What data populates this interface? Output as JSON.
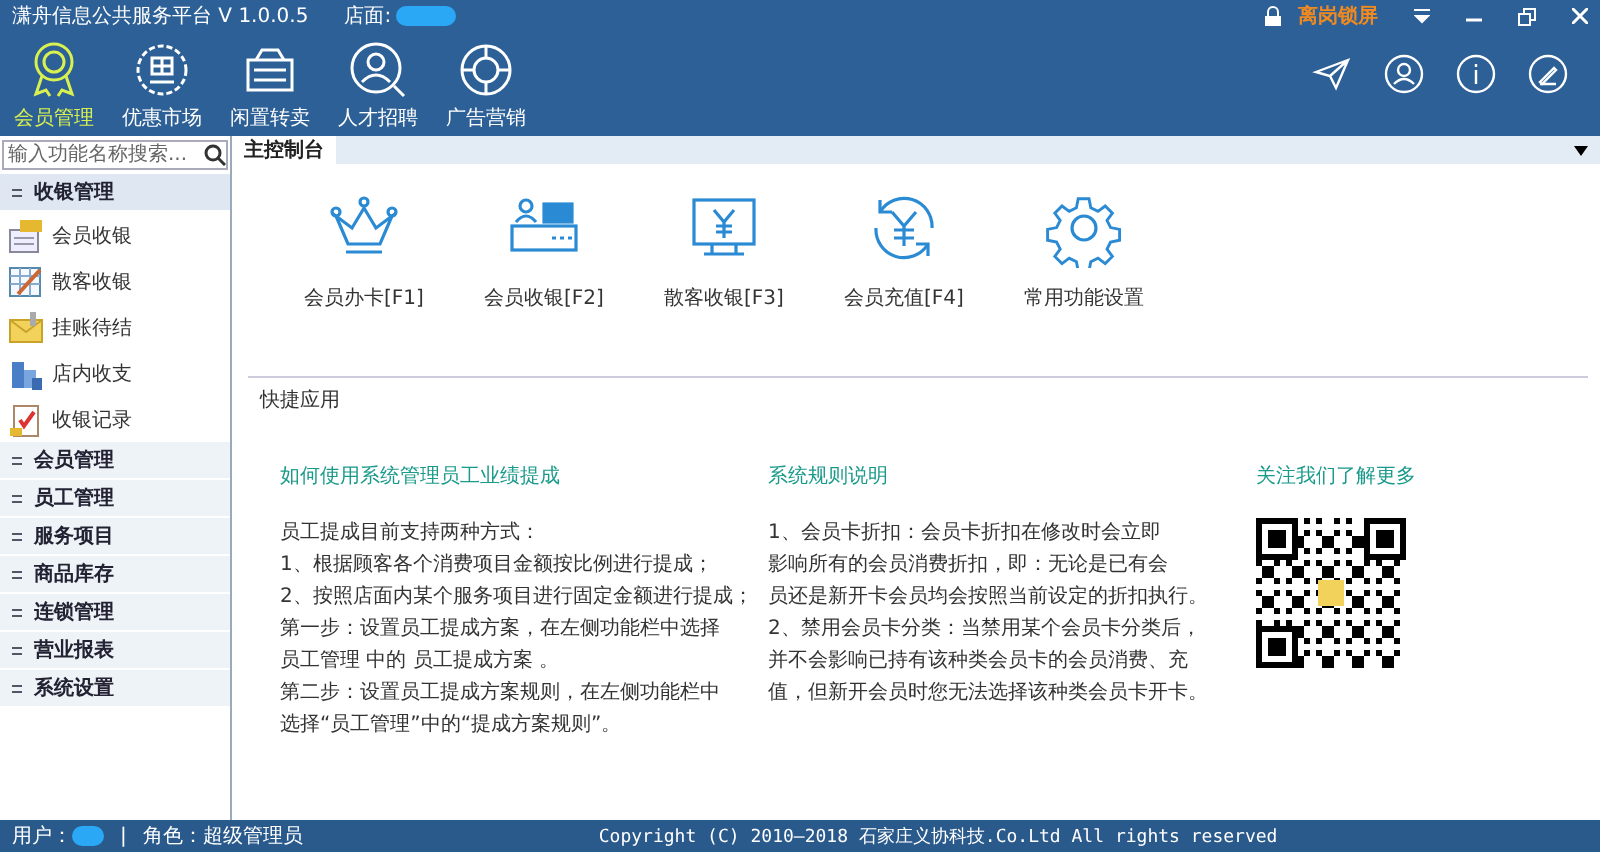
{
  "window": {
    "title": "潇舟信息公共服务平台 V 1.0.0.5",
    "store_label": "店面:",
    "lock_label": "离岗锁屏"
  },
  "nav": [
    {
      "label": "会员管理",
      "kind": "medal",
      "selected": true
    },
    {
      "label": "优惠市场",
      "kind": "coupon",
      "selected": false
    },
    {
      "label": "闲置转卖",
      "kind": "sale",
      "selected": false
    },
    {
      "label": "人才招聘",
      "kind": "person",
      "selected": false
    },
    {
      "label": "广告营销",
      "kind": "ring",
      "selected": false
    }
  ],
  "sidebar": {
    "search_placeholder": "输入功能名称搜索...",
    "groups": [
      {
        "label": "收银管理",
        "expanded": true,
        "children": [
          {
            "label": "会员收银",
            "kind": "register"
          },
          {
            "label": "散客收银",
            "kind": "sheet"
          },
          {
            "label": "挂账待结",
            "kind": "envelope"
          },
          {
            "label": "店内收支",
            "kind": "building"
          },
          {
            "label": "收银记录",
            "kind": "clipboard"
          }
        ]
      },
      {
        "label": "会员管理",
        "expanded": false
      },
      {
        "label": "员工管理",
        "expanded": false
      },
      {
        "label": "服务项目",
        "expanded": false
      },
      {
        "label": "商品库存",
        "expanded": false
      },
      {
        "label": "连锁管理",
        "expanded": false
      },
      {
        "label": "营业报表",
        "expanded": false
      },
      {
        "label": "系统设置",
        "expanded": false
      }
    ]
  },
  "tabs": [
    {
      "label": "主控制台",
      "selected": true
    }
  ],
  "shortcuts": [
    {
      "label": "会员办卡[F1]",
      "kind": "crown"
    },
    {
      "label": "会员收银[F2]",
      "kind": "counter"
    },
    {
      "label": "散客收银[F3]",
      "kind": "monitor"
    },
    {
      "label": "会员充值[F4]",
      "kind": "recharge"
    },
    {
      "label": "常用功能设置",
      "kind": "gear"
    }
  ],
  "quick_apps": {
    "title": "快捷应用",
    "columns": [
      {
        "kind": "text",
        "title": "如何使用系统管理员工业绩提成",
        "lines": [
          "员工提成目前支持两种方式：",
          "1、根据顾客各个消费项目金额按比例进行提成；",
          "2、按照店面内某个服务项目进行固定金额进行提成；",
          "第一步：设置员工提成方案，在左侧功能栏中选择",
          "员工管理 中的 员工提成方案 。",
          "第二步：设置员工提成方案规则，在左侧功能栏中",
          "选择“员工管理”中的“提成方案规则”。"
        ]
      },
      {
        "kind": "text",
        "title": "系统规则说明",
        "lines": [
          "1、会员卡折扣：会员卡折扣在修改时会立即",
          "影响所有的会员消费折扣，即：无论是已有会",
          "员还是新开卡会员均会按照当前设定的折扣执行。",
          "2、禁用会员卡分类：当禁用某个会员卡分类后，",
          "并不会影响已持有该种类会员卡的会员消费、充",
          "值，但新开会员时您无法选择该种类会员卡开卡。"
        ]
      },
      {
        "kind": "qr",
        "title": "关注我们了解更多"
      }
    ]
  },
  "status_bar": {
    "user_label": "用户：",
    "separator": "|",
    "role": "角色：超级管理员",
    "copyright": "Copyright (C) 2010—2018 石家庄义协科技.Co.Ltd  All rights reserved"
  }
}
